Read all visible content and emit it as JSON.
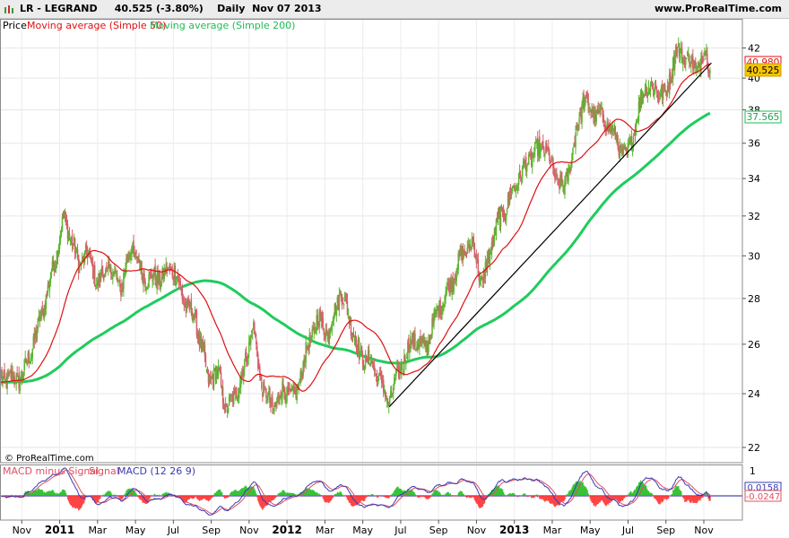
{
  "header": {
    "ticker": "LR - LEGRAND",
    "price_change": "40.525 (-3.80%)",
    "timeframe": "Daily",
    "date": "Nov 07 2013",
    "site": "www.ProRealTime.com"
  },
  "price_panel": {
    "legend_price": "Price",
    "legend_ma50": "Moving average (Simple 50)",
    "legend_ma200": "Moving average (Simple 200)",
    "watermark": "© ProRealTime.com",
    "badge_ma50": "40.980",
    "badge_price": "40.525",
    "badge_ma200": "37.565"
  },
  "macd_panel": {
    "legend_hist": "MACD minus Signal",
    "legend_signal": "Signal",
    "legend_macd": "MACD (12 26 9)",
    "badge_value": "0.0158",
    "badge_value2": "-0.0247",
    "ytick_top": "1"
  },
  "colors": {
    "candle_up": "#5cb531",
    "candle_down": "#d4606a",
    "ma50": "#e01010",
    "ma200": "#1fcc5c",
    "trendline": "#000000",
    "macd_line": "#3a3ab5",
    "signal_line": "#e05060",
    "hist_up": "#22bb22",
    "hist_down": "#ff3030",
    "price_badge": "#f5c400"
  },
  "chart_data": {
    "type": "line",
    "scale": "log",
    "ylim": [
      21.5,
      44
    ],
    "yticks": [
      22,
      24,
      26,
      28,
      30,
      32,
      34,
      36,
      38,
      40,
      42
    ],
    "x_labels": [
      "Nov",
      "2011",
      "Mar",
      "May",
      "Jul",
      "Sep",
      "Nov",
      "2012",
      "Mar",
      "May",
      "Jul",
      "Sep",
      "Nov",
      "2013",
      "Mar",
      "May",
      "Jul",
      "Sep",
      "Nov"
    ],
    "x_months": [
      0,
      2,
      4,
      6,
      8,
      10,
      12,
      14,
      16,
      18,
      20,
      22,
      24,
      26,
      28,
      30,
      32,
      34,
      36
    ],
    "price_anchors": [
      [
        0,
        24.6
      ],
      [
        0.8,
        26.5
      ],
      [
        1.6,
        29.2
      ],
      [
        2.2,
        31.8
      ],
      [
        2.6,
        31.0
      ],
      [
        3.0,
        29.5
      ],
      [
        3.4,
        30.2
      ],
      [
        4.0,
        28.7
      ],
      [
        4.6,
        29.5
      ],
      [
        5.2,
        28.5
      ],
      [
        5.8,
        30.5
      ],
      [
        6.4,
        29.0
      ],
      [
        7.2,
        28.9
      ],
      [
        8.0,
        29.4
      ],
      [
        8.6,
        27.8
      ],
      [
        9.2,
        27.0
      ],
      [
        9.8,
        24.6
      ],
      [
        10.4,
        24.8
      ],
      [
        10.8,
        23.3
      ],
      [
        11.6,
        24.6
      ],
      [
        12.2,
        26.8
      ],
      [
        12.6,
        24.5
      ],
      [
        13.2,
        23.4
      ],
      [
        13.8,
        24.2
      ],
      [
        14.4,
        23.8
      ],
      [
        15.0,
        25.6
      ],
      [
        15.6,
        27.1
      ],
      [
        16.2,
        26.5
      ],
      [
        16.8,
        28.3
      ],
      [
        17.2,
        27.4
      ],
      [
        17.8,
        25.6
      ],
      [
        18.4,
        25.3
      ],
      [
        19.0,
        24.4
      ],
      [
        19.3,
        23.6
      ],
      [
        19.9,
        24.8
      ],
      [
        20.6,
        26.2
      ],
      [
        21.3,
        25.8
      ],
      [
        22.0,
        27.6
      ],
      [
        22.6,
        28.6
      ],
      [
        23.2,
        30.0
      ],
      [
        23.8,
        30.6
      ],
      [
        24.3,
        28.6
      ],
      [
        25.0,
        31.3
      ],
      [
        25.6,
        32.6
      ],
      [
        26.3,
        34.2
      ],
      [
        27.0,
        35.4
      ],
      [
        27.6,
        35.8
      ],
      [
        28.1,
        34.3
      ],
      [
        28.6,
        33.3
      ],
      [
        29.1,
        35.6
      ],
      [
        29.6,
        38.6
      ],
      [
        30.2,
        37.8
      ],
      [
        30.8,
        37.4
      ],
      [
        31.4,
        36.2
      ],
      [
        31.9,
        35.1
      ],
      [
        32.4,
        37.1
      ],
      [
        32.9,
        39.6
      ],
      [
        33.4,
        39.3
      ],
      [
        34.0,
        38.9
      ],
      [
        34.5,
        41.8
      ],
      [
        35.1,
        41.4
      ],
      [
        35.6,
        40.6
      ],
      [
        36.1,
        41.7
      ],
      [
        36.35,
        40.5
      ]
    ],
    "trendline": [
      [
        19.4,
        23.5
      ],
      [
        36.4,
        41.0
      ]
    ],
    "series": [
      {
        "name": "Price"
      },
      {
        "name": "Moving average (Simple 50)"
      },
      {
        "name": "Moving average (Simple 200)"
      }
    ],
    "last_values": {
      "price": 40.525,
      "ma50": 40.98,
      "ma200": 37.565
    }
  }
}
